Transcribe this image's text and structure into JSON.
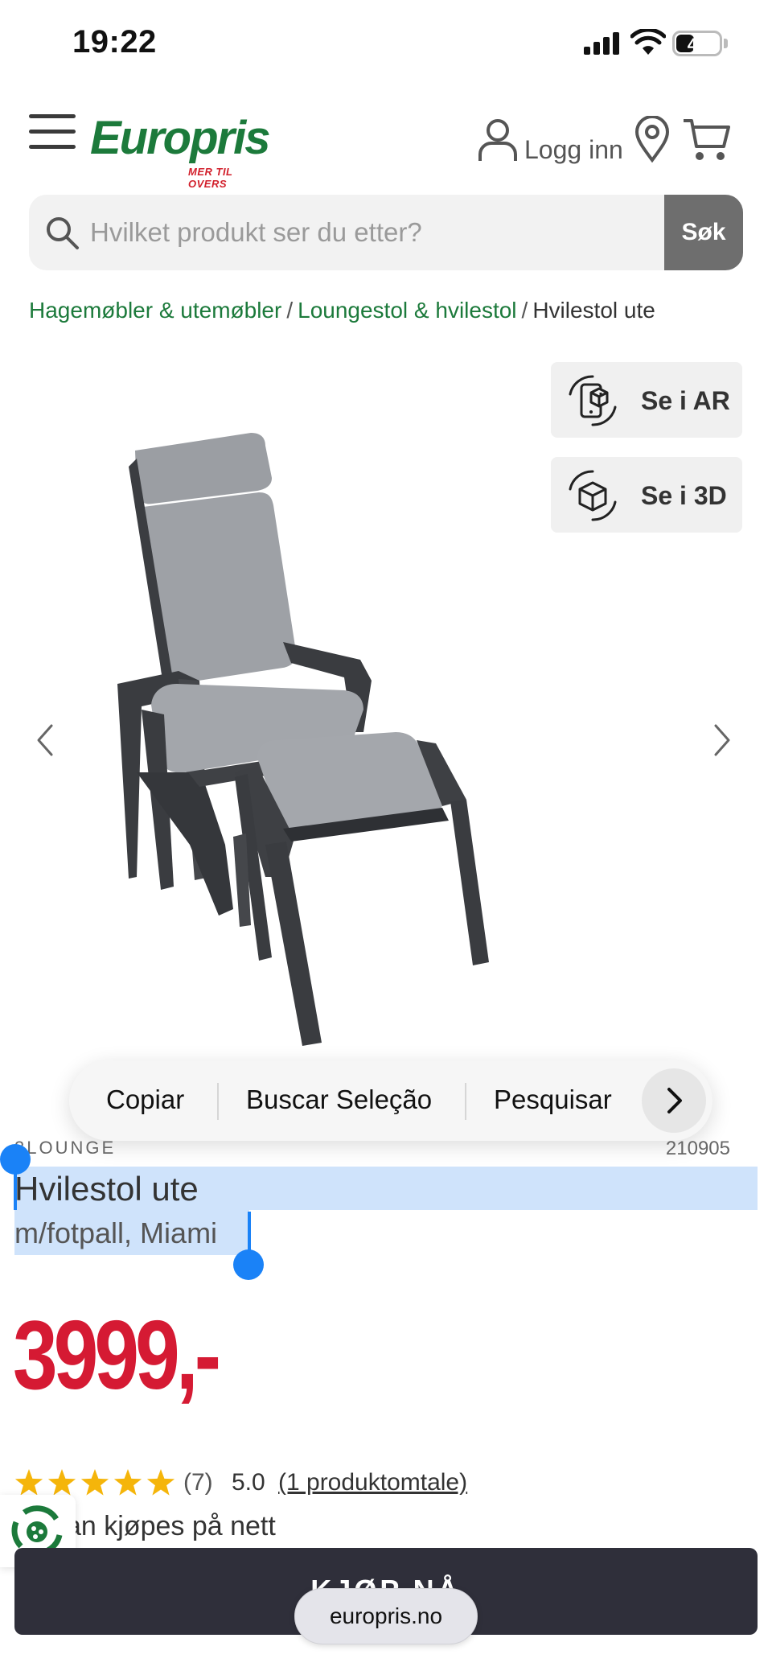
{
  "status_bar": {
    "time": "19:22",
    "battery": "42",
    "battery_level": 0.42
  },
  "header": {
    "logo_word": "Europris",
    "logo_tagline": "MER TIL OVERS",
    "login_label": "Logg inn",
    "icons": [
      "menu-icon",
      "user-icon",
      "location-pin-icon",
      "cart-icon"
    ]
  },
  "search": {
    "placeholder": "Hvilket produkt ser du etter?",
    "value": "",
    "button_label": "Søk"
  },
  "breadcrumb": [
    {
      "label": "Hagemøbler & utemøbler",
      "link": true
    },
    {
      "label": "Loungestol & hvilestol",
      "link": true
    },
    {
      "label": "Hvilestol ute",
      "link": false
    }
  ],
  "view_buttons": {
    "ar_label": "Se i AR",
    "threed_label": "Se i 3D"
  },
  "context_menu": {
    "items": [
      "Copiar",
      "Buscar Seleção",
      "Pesquisar"
    ]
  },
  "product": {
    "brand": "3LOUNGE",
    "sku": "210905",
    "title": "Hvilestol ute",
    "subtitle": "m/fotpall, Miami",
    "price": "3999,-",
    "price_color": "#d51a33",
    "rating_stars": 5,
    "rating_count": "(7)",
    "rating_score": "5.0",
    "reviews_link": "(1 produktomtale)",
    "availability": "an kjøpes på nett",
    "buy_label": "KJØP NÅ"
  },
  "browser": {
    "url": "europris.no"
  },
  "colors": {
    "brand_green": "#1c7a3b",
    "brand_red": "#d21f2b",
    "star": "#f5b50a",
    "selection": "#cfe3fb",
    "handle": "#1a82f7"
  }
}
